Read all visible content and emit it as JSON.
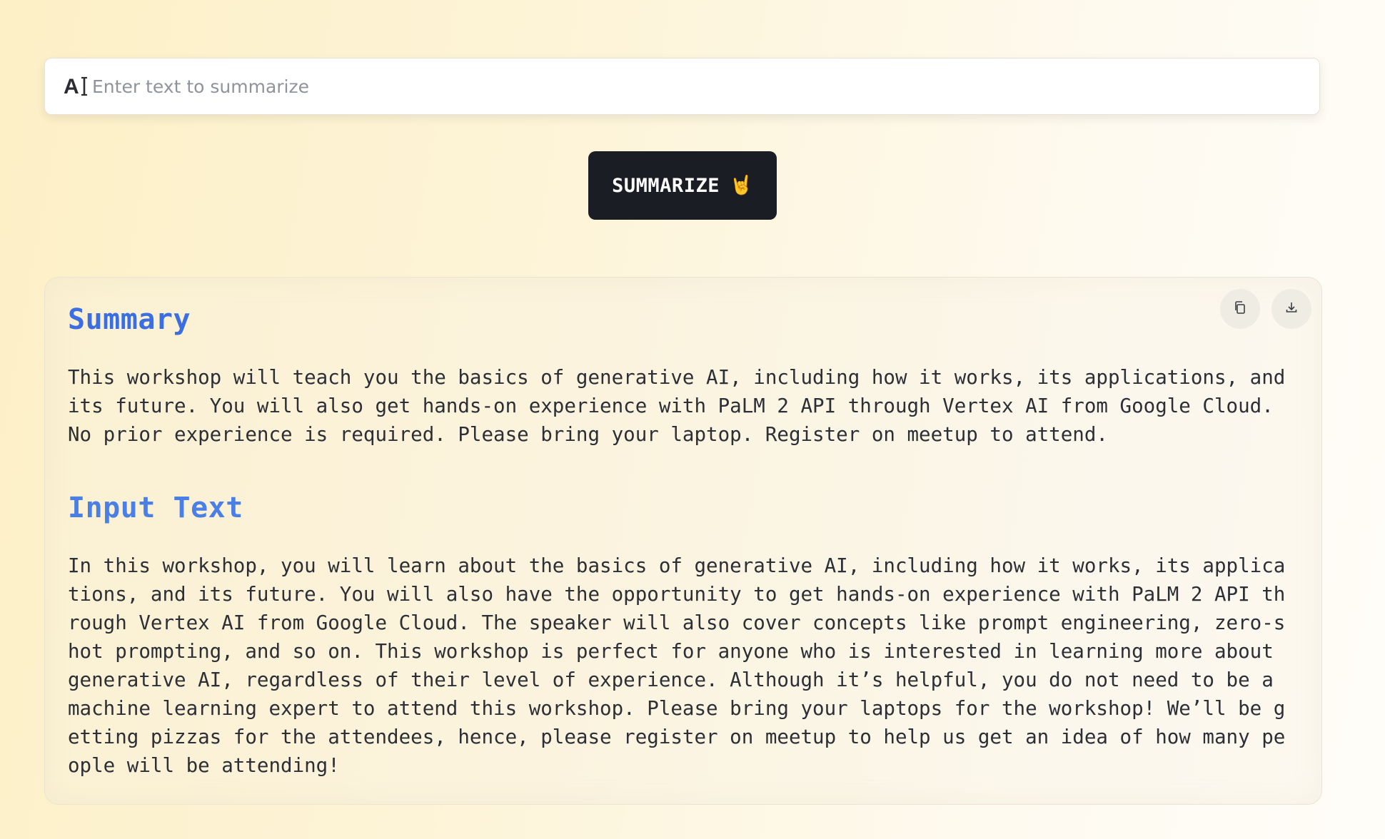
{
  "search": {
    "icon": "text-cursor-ai-icon",
    "placeholder": "Enter text to summarize",
    "value": ""
  },
  "action": {
    "label": "SUMMARIZE",
    "emoji": "🤘"
  },
  "result": {
    "copy_icon": "copy-icon",
    "download_icon": "download-icon",
    "summary_heading": "Summary",
    "summary_text": "This workshop will teach you the basics of generative AI, including how it works, its applications, and its future. You will also get hands-on experience with PaLM 2 API through Vertex AI from Google Cloud. No prior experience is required. Please bring your laptop. Register on meetup to attend.",
    "input_heading": "Input Text",
    "input_text": "In this workshop, you will learn about the basics of generative AI, including how it works, its applications, and its future. You will also have the opportunity to get hands-on experience with PaLM 2 API through Vertex AI from Google Cloud.  The speaker will also cover concepts like prompt engineering, zero-shot prompting, and so on. This workshop is perfect for anyone who is interested in learning more about generative AI, regardless of their level of experience.  Although it’s helpful, you do not need to be a machine learning expert to attend this workshop. Please bring your laptops for the workshop!  We’ll be getting pizzas for the attendees, hence, please register on meetup to help us get an idea of how many people will be attending!"
  },
  "colors": {
    "heading": "#3b6ee0",
    "button_bg": "#1b1d24",
    "text": "#2c2f36"
  }
}
